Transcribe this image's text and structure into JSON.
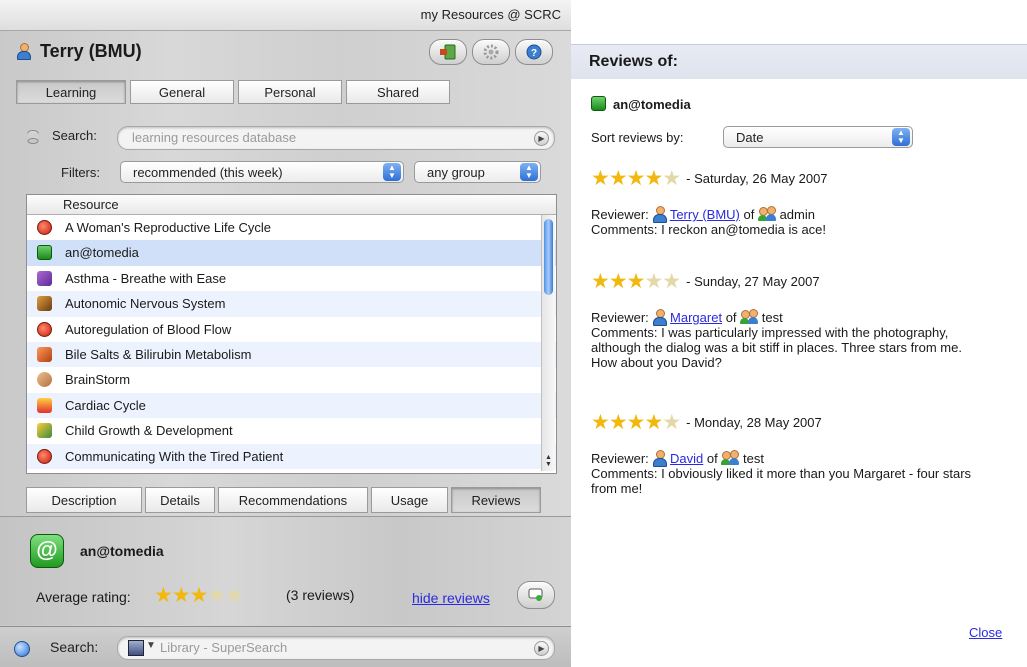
{
  "window": {
    "title": "my Resources @ SCRC"
  },
  "user": {
    "name": "Terry (BMU)"
  },
  "toolbar": {
    "exit_icon": "exit-door-icon",
    "settings_icon": "gear-icon",
    "help_icon": "help-icon"
  },
  "main_tabs": [
    "Learning",
    "General",
    "Personal",
    "Shared"
  ],
  "search": {
    "label": "Search:",
    "placeholder": "learning resources database"
  },
  "filters": {
    "label": "Filters:",
    "value": "recommended (this week)",
    "group_value": "any group"
  },
  "resources": {
    "column_header": "Resource",
    "items": [
      "A Woman's Reproductive Life Cycle",
      "an@tomedia",
      "Asthma - Breathe with Ease",
      "Autonomic Nervous System",
      "Autoregulation of Blood Flow",
      "Bile Salts & Bilirubin Metabolism",
      "BrainStorm",
      "Cardiac Cycle",
      "Child Growth & Development",
      "Communicating With the Tired Patient"
    ],
    "selected": "an@tomedia"
  },
  "bottom_tabs": [
    "Description",
    "Details",
    "Recommendations",
    "Usage",
    "Reviews"
  ],
  "detail": {
    "title": "an@tomedia",
    "average_rating_label": "Average rating:",
    "average_rating": 3,
    "review_count": "(3 reviews)",
    "hide_reviews": "hide reviews"
  },
  "bottom_search": {
    "label": "Search:",
    "placeholder": "Library - SuperSearch"
  },
  "reviews_panel": {
    "heading": "Reviews of:",
    "resource": "an@tomedia",
    "sort_label": "Sort reviews by:",
    "sort_value": "Date",
    "reviews": [
      {
        "stars": 4,
        "date": "- Saturday, 26 May 2007",
        "reviewer_label": "Reviewer:",
        "reviewer": "Terry (BMU)",
        "of_label": "of",
        "group": "admin",
        "comments": "Comments: I reckon an@tomedia is ace!"
      },
      {
        "stars": 3,
        "date": "- Sunday, 27 May 2007",
        "reviewer_label": "Reviewer:",
        "reviewer": "Margaret",
        "of_label": "of",
        "group": "test",
        "comments": "Comments: I was particularly impressed with the photography, although the dialog was a bit stiff in places. Three stars from me. How about you David?"
      },
      {
        "stars": 4,
        "date": "- Monday, 28 May 2007",
        "reviewer_label": "Reviewer:",
        "reviewer": "David",
        "of_label": "of",
        "group": "test",
        "comments": "Comments: I obviously liked it more than you Margaret - four stars from me!"
      }
    ],
    "close": "Close"
  }
}
